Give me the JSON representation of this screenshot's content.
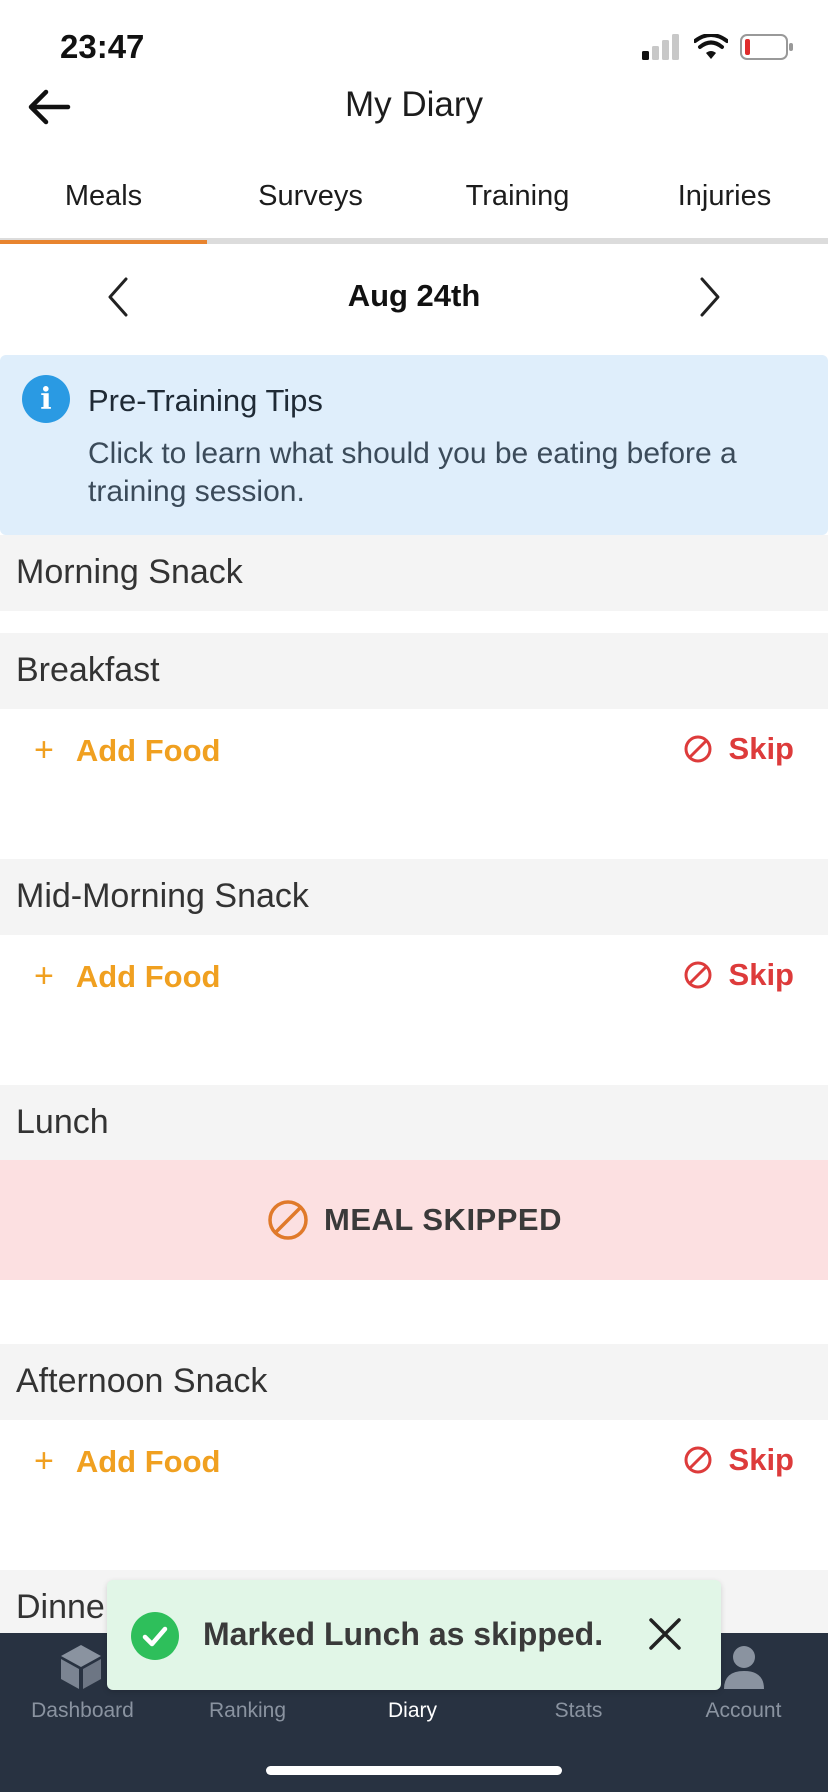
{
  "status_bar": {
    "time": "23:47"
  },
  "header": {
    "title": "My Diary"
  },
  "tabs": [
    {
      "label": "Meals",
      "active": true
    },
    {
      "label": "Surveys",
      "active": false
    },
    {
      "label": "Training",
      "active": false
    },
    {
      "label": "Injuries",
      "active": false
    }
  ],
  "date_nav": {
    "date": "Aug 24th"
  },
  "tip": {
    "title": "Pre-Training Tips",
    "body": "Click to learn what should you be eating before a training session.",
    "icon": "info-icon"
  },
  "meals": {
    "morning_snack": {
      "name": "Morning Snack"
    },
    "breakfast": {
      "name": "Breakfast",
      "add_label": "Add Food",
      "skip_label": "Skip"
    },
    "mid_morning_snack": {
      "name": "Mid-Morning Snack",
      "add_label": "Add Food",
      "skip_label": "Skip"
    },
    "lunch": {
      "name": "Lunch",
      "skipped_label": "MEAL SKIPPED"
    },
    "afternoon_snack": {
      "name": "Afternoon Snack",
      "add_label": "Add Food",
      "skip_label": "Skip"
    },
    "dinner": {
      "name": "Dinne"
    }
  },
  "bottom_nav": [
    {
      "label": "Dashboard",
      "icon": "cube-icon",
      "active": false
    },
    {
      "label": "Ranking",
      "icon": "trophy-icon",
      "active": false
    },
    {
      "label": "Diary",
      "icon": "diary-icon",
      "active": true
    },
    {
      "label": "Stats",
      "icon": "chart-icon",
      "active": false
    },
    {
      "label": "Account",
      "icon": "person-icon",
      "active": false
    }
  ],
  "toast": {
    "message": "Marked Lunch as skipped."
  },
  "colors": {
    "accent": "#e8842e",
    "add_food": "#f0a020",
    "skip": "#dd3b3b",
    "tip_bg": "#dfeefb",
    "skipped_bg": "#fce0e1",
    "nav_bg": "#283241",
    "toast_bg": "#e1f6e7"
  }
}
